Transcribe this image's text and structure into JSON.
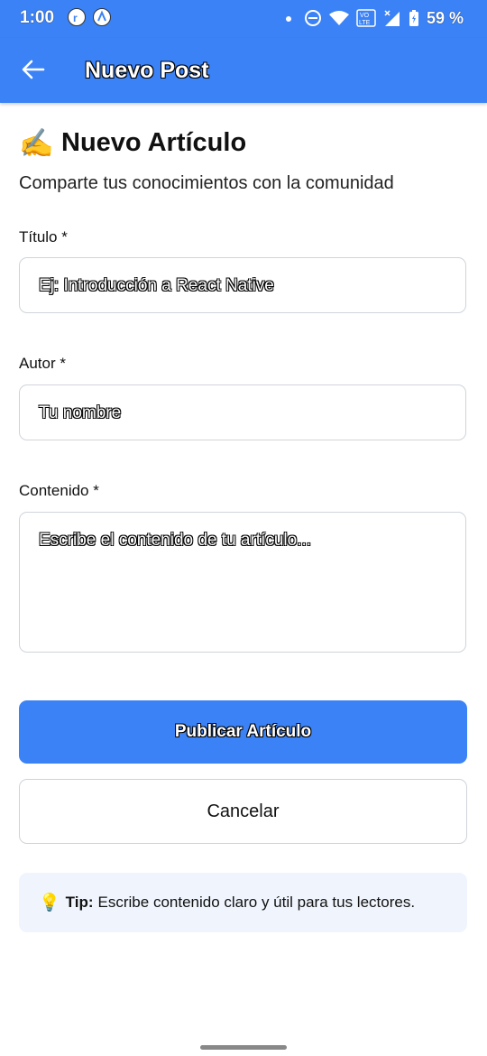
{
  "status_bar": {
    "time": "1:00",
    "battery": "59 %",
    "icons": [
      "app-r-icon",
      "app-a-icon",
      "notification-dot-icon",
      "dnd-icon",
      "wifi-icon",
      "volte-icon",
      "signal-icon",
      "battery-icon"
    ]
  },
  "app_bar": {
    "title": "Nuevo Post",
    "back_icon": "arrow-left-icon",
    "color": "#3b82f6"
  },
  "page": {
    "heading_emoji": "✍️",
    "heading": "Nuevo Artículo",
    "subtitle": "Comparte tus conocimientos con la comunidad"
  },
  "form": {
    "title_label": "Título *",
    "title_placeholder": "Ej: Introducción a React Native",
    "author_label": "Autor *",
    "author_placeholder": "Tu nombre",
    "content_label": "Contenido *",
    "content_placeholder": "Escribe el contenido de tu artículo..."
  },
  "actions": {
    "publish_label": "Publicar Artículo",
    "cancel_label": "Cancelar"
  },
  "tip": {
    "icon": "💡",
    "bold": "Tip:",
    "text": "Escribe contenido claro y útil para tus lectores."
  }
}
